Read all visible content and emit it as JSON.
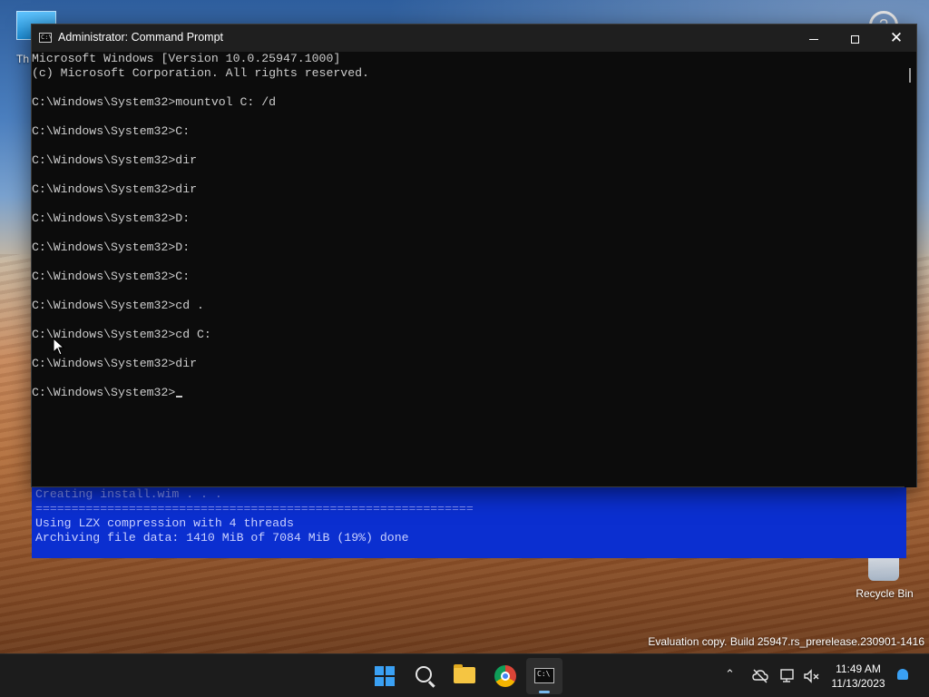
{
  "desktop": {
    "top_icon_label": "Th",
    "recycle_bin_label": "Recycle Bin",
    "watermark": "Evaluation copy. Build 25947.rs_prerelease.230901-1416"
  },
  "background_console": {
    "lines": [
      "Creating install.wim . . .",
      "=============================================================",
      "",
      "Using LZX compression with 4 threads",
      "Archiving file data: 1410 MiB of 7084 MiB (19%) done"
    ],
    "progress_percent": 19
  },
  "cmd": {
    "title": "Administrator: Command Prompt",
    "title_icon": "C:\\",
    "lines": [
      "Microsoft Windows [Version 10.0.25947.1000]",
      "(c) Microsoft Corporation. All rights reserved.",
      "",
      "C:\\Windows\\System32>mountvol C: /d",
      "",
      "C:\\Windows\\System32>C:",
      "",
      "C:\\Windows\\System32>dir",
      "",
      "C:\\Windows\\System32>dir",
      "",
      "C:\\Windows\\System32>D:",
      "",
      "C:\\Windows\\System32>D:",
      "",
      "C:\\Windows\\System32>C:",
      "",
      "C:\\Windows\\System32>cd .",
      "",
      "C:\\Windows\\System32>cd C:",
      "",
      "C:\\Windows\\System32>dir",
      "",
      "C:\\Windows\\System32>"
    ],
    "buttons": {
      "minimize": "minimize",
      "maximize": "maximize",
      "close": "✕"
    }
  },
  "taskbar": {
    "apps": [
      {
        "name": "start-icon"
      },
      {
        "name": "search-icon"
      },
      {
        "name": "file-explorer-icon"
      },
      {
        "name": "chrome-icon"
      },
      {
        "name": "command-prompt-icon",
        "active": true
      }
    ],
    "tray": {
      "chevron": "⌃",
      "time": "11:49 AM",
      "date": "11/13/2023"
    }
  }
}
